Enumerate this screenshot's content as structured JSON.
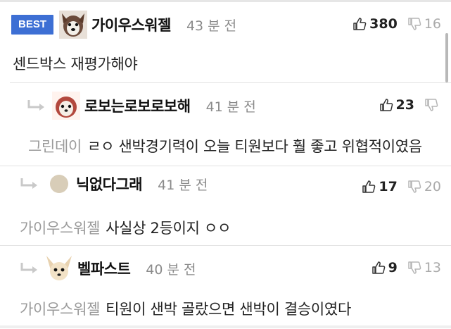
{
  "comments": [
    {
      "badge": "BEST",
      "nickname": "가이우스워젤",
      "time": "43 분 전",
      "upvotes": "380",
      "downvotes": "16",
      "text": "센드박스 재평가해야"
    },
    {
      "nickname": "로보는로보로보해",
      "time": "41 분 전",
      "upvotes": "23",
      "downvotes": "",
      "mention": "그린데이",
      "text": "ㄹㅇ 샌박경기력이 오늘 티원보다 훨 좋고 위협적이였음"
    },
    {
      "nickname": "닉없다그래",
      "time": "41 분 전",
      "upvotes": "17",
      "downvotes": "20",
      "mention": "가이우스워젤",
      "text": "사실상 2등이지 ㅇㅇ"
    },
    {
      "nickname": "벨파스트",
      "time": "40 분 전",
      "upvotes": "9",
      "downvotes": "13",
      "mention": "가이우스워젤",
      "text": "티원이 샌박 골랐으면 샌박이 결승이였다"
    }
  ],
  "colors": {
    "best_badge": "#3d6fd4",
    "reply_arrow": "#c9c9c9",
    "muted_text": "#8a8a8a"
  },
  "icons": [
    "thumbs-up-icon",
    "thumbs-down-icon",
    "reply-arrow-icon"
  ]
}
